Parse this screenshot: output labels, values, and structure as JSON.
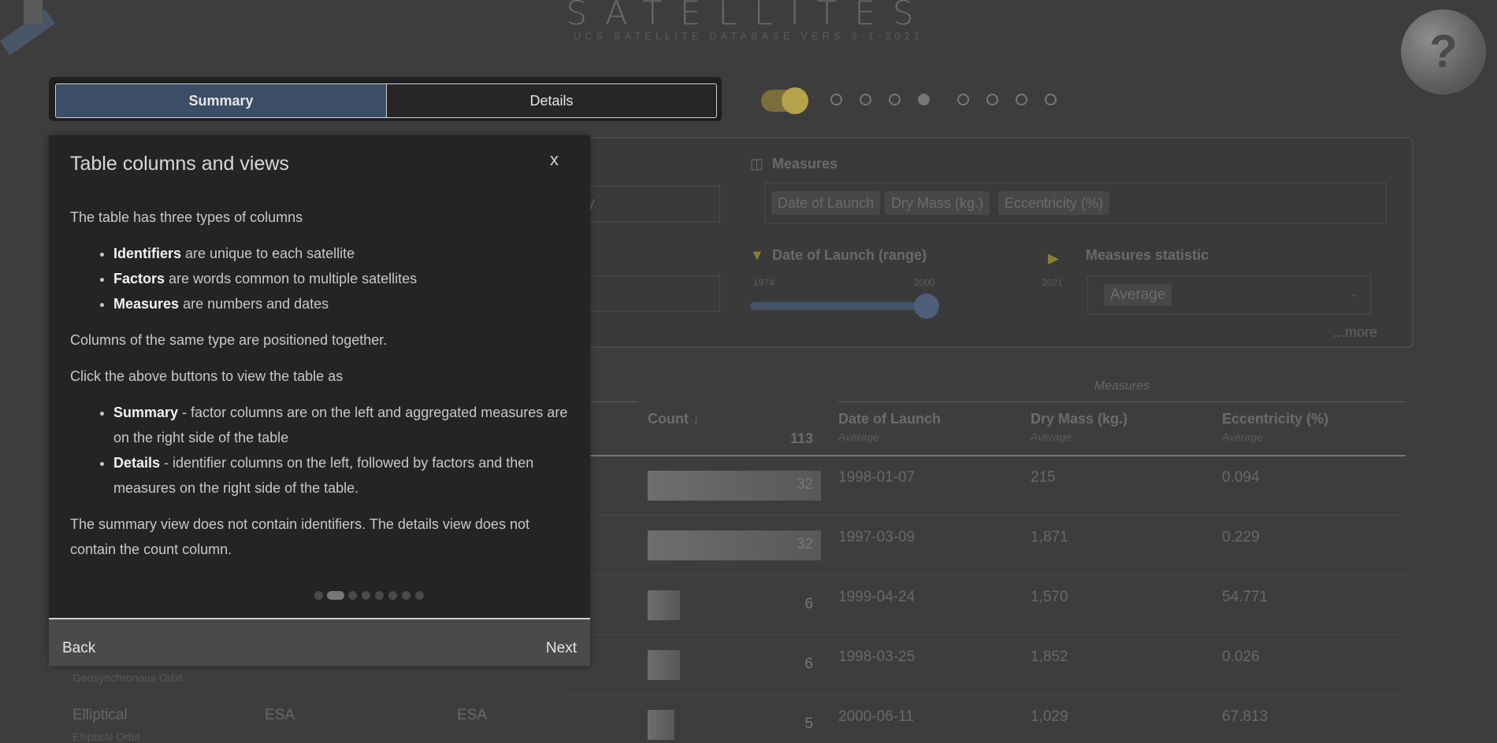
{
  "header": {
    "title": "SATELLITES",
    "subtitle": "UCS SATELLITE DATABASE VERS 9-1-2021",
    "help_icon": "question-moon-icon"
  },
  "view_switch": {
    "summary_label": "Summary",
    "details_label": "Details",
    "selected": "Summary"
  },
  "tour_steps": {
    "count": 8,
    "active_index": 3
  },
  "panel": {
    "partial_chip_text": "ry",
    "measures_label": "Measures",
    "measures_chips": [
      "Date of Launch",
      "Dry Mass (kg.)",
      "Eccentricity (%)"
    ],
    "filter_label": "Date of Launch (range)",
    "range_min": "1974",
    "range_value": "2000",
    "range_max": "2021",
    "statistic_label": "Measures statistic",
    "statistic_value": "Average",
    "more_link": "...more"
  },
  "table": {
    "group_header": "Measures",
    "count_header": "Count ↓",
    "count_total": "113",
    "columns": [
      {
        "label": "Date of Launch",
        "sub": "Average"
      },
      {
        "label": "Dry Mass (kg.)",
        "sub": "Average"
      },
      {
        "label": "Eccentricity (%)",
        "sub": "Average"
      }
    ],
    "rows": [
      {
        "count": "32",
        "count_value": 32,
        "date": "1998-01-07",
        "mass": "215",
        "ecc": "0.094"
      },
      {
        "count": "32",
        "count_value": 32,
        "date": "1997-03-09",
        "mass": "1,871",
        "ecc": "0.229"
      },
      {
        "count": "6",
        "count_value": 6,
        "date": "1999-04-24",
        "mass": "1,570",
        "ecc": "54.771"
      },
      {
        "count": "6",
        "count_value": 6,
        "date": "1998-03-25",
        "mass": "1,852",
        "ecc": "0.026"
      },
      {
        "count": "5",
        "count_value": 5,
        "date": "2000-06-11",
        "mass": "1,029",
        "ecc": "67.813"
      }
    ],
    "row4_sub": "Geosynchronous Orbit",
    "row5_factor1": "Elliptical",
    "row5_factor2": "ESA",
    "row5_factor3": "ESA",
    "row5_sub": "Elliptical Orbit"
  },
  "modal": {
    "title": "Table columns and views",
    "close_label": "x",
    "intro": "The table has three types of columns",
    "types": [
      {
        "term": "Identifiers",
        "text": " are unique to each satellite"
      },
      {
        "term": "Factors",
        "text": " are words common to multiple satellites"
      },
      {
        "term": "Measures",
        "text": " are numbers and dates"
      }
    ],
    "positioned": "Columns of the same type are positioned together.",
    "click_intro": "Click the above buttons to view the table as",
    "views": [
      {
        "term": "Summary",
        "text": " - factor columns are on the left and aggregated measures are on the right side of the table"
      },
      {
        "term": "Details",
        "text": " - identifier columns on the left, followed by factors and then measures on the right side of the table."
      }
    ],
    "note": "The summary view does not contain identifiers. The details view does not contain the count column.",
    "pager": {
      "count": 8,
      "active_index": 1
    },
    "back_label": "Back",
    "next_label": "Next"
  }
}
